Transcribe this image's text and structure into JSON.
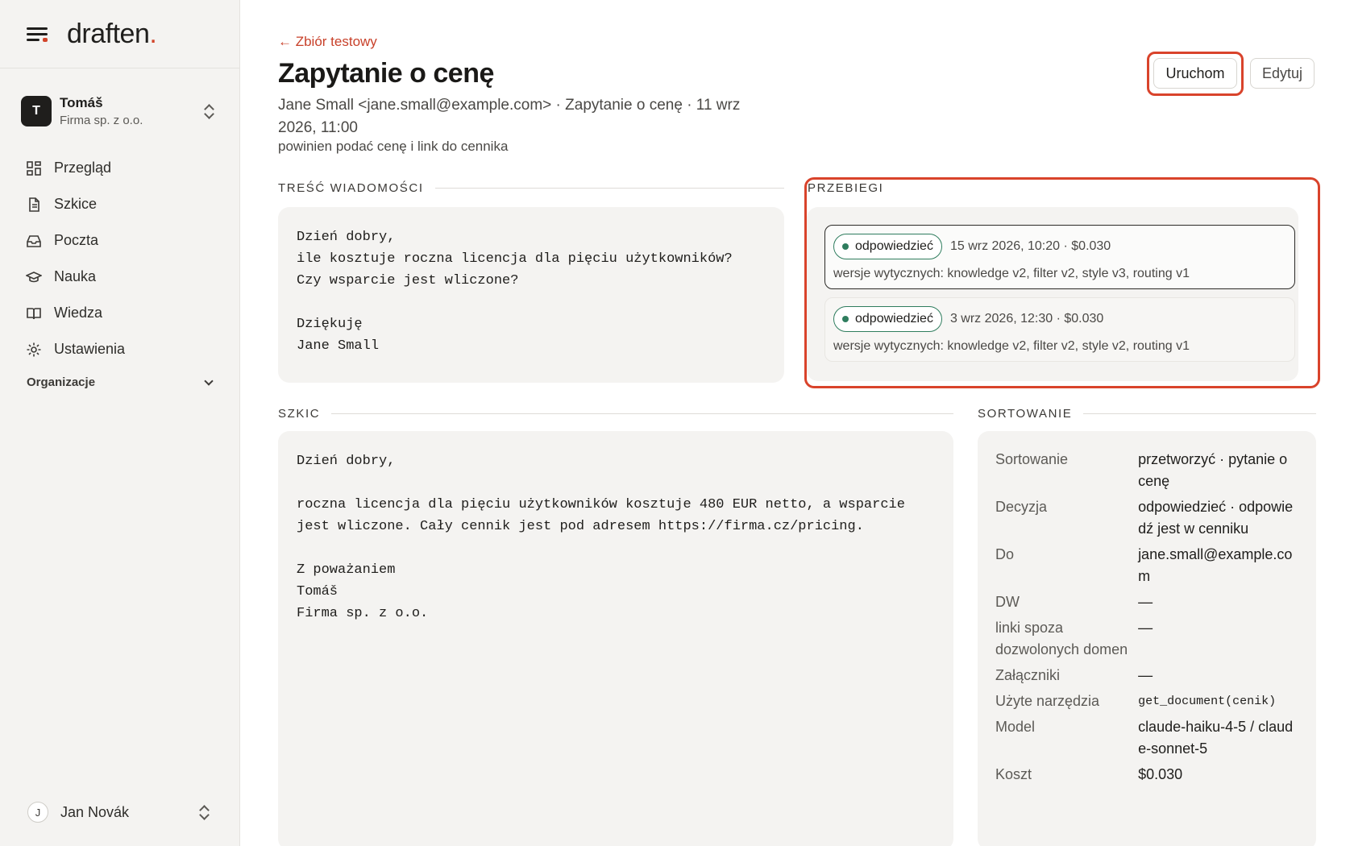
{
  "app": {
    "logo_text": "draften",
    "logo_dot": "."
  },
  "org": {
    "initial": "T",
    "name": "Tomáš",
    "company": "Firma sp. z o.o."
  },
  "nav": [
    {
      "label": "Przegląd",
      "icon": "grid-icon"
    },
    {
      "label": "Szkice",
      "icon": "document-icon"
    },
    {
      "label": "Poczta",
      "icon": "inbox-icon"
    },
    {
      "label": "Nauka",
      "icon": "graduation-cap-icon"
    },
    {
      "label": "Wiedza",
      "icon": "book-icon"
    },
    {
      "label": "Ustawienia",
      "icon": "gear-icon"
    }
  ],
  "org_section": {
    "label": "Organizacje"
  },
  "user": {
    "initial": "J",
    "name": "Jan Novák"
  },
  "page": {
    "back_label": "← Zbiór testowy",
    "title": "Zapytanie o cenę",
    "meta": "Jane Small <jane.small@example.com> · Zapytanie o cenę · 11 wrz 2026, 11:00",
    "expectation": "powinien podać cenę i link do cennika"
  },
  "actions": {
    "run": "Uruchom",
    "edit": "Edytuj"
  },
  "sections": {
    "message": "TREŚĆ WIADOMOŚCI",
    "runs": "PRZEBIEGI",
    "draft": "SZKIC",
    "sorting": "SORTOWANIE"
  },
  "message_body": "Dzień dobry,\nile kosztuje roczna licencja dla pięciu użytkowników?\nCzy wsparcie jest wliczone?\n\nDziękuję\nJane Small",
  "runs": [
    {
      "status": "odpowiedzieć",
      "info": "15 wrz 2026, 10:20 · $0.030",
      "versions": "wersje wytycznych: knowledge v2, filter v2, style v3, routing v1"
    },
    {
      "status": "odpowiedzieć",
      "info": "3 wrz 2026, 12:30 · $0.030",
      "versions": "wersje wytycznych: knowledge v2, filter v2, style v2, routing v1"
    }
  ],
  "draft_body": "Dzień dobry,\n\nroczna licencja dla pięciu użytkowników kosztuje 480 EUR netto, a wsparcie\njest wliczone. Cały cennik jest pod adresem https://firma.cz/pricing.\n\nZ poważaniem\nTomáš\nFirma sp. z o.o.",
  "sorting": [
    {
      "key": "Sortowanie",
      "value": "przetworzyć · pytanie o cenę"
    },
    {
      "key": "Decyzja",
      "value": "odpowiedzieć · odpowiedź jest w cenniku"
    },
    {
      "key": "Do",
      "value": "jane.small@example.com"
    },
    {
      "key": "DW",
      "value": "—"
    },
    {
      "key": "linki spoza dozwolonych domen",
      "value": "—"
    },
    {
      "key": "Załączniki",
      "value": "—"
    },
    {
      "key": "Użyte narzędzia",
      "value": "get_document(cenik)"
    },
    {
      "key": "Model",
      "value": "claude-haiku-4-5 / claude-sonnet-5"
    },
    {
      "key": "Koszt",
      "value": "$0.030"
    }
  ],
  "colors": {
    "accent": "#d2442a",
    "status_green": "#2f7d5e",
    "panel_bg": "#f4f3f1"
  }
}
